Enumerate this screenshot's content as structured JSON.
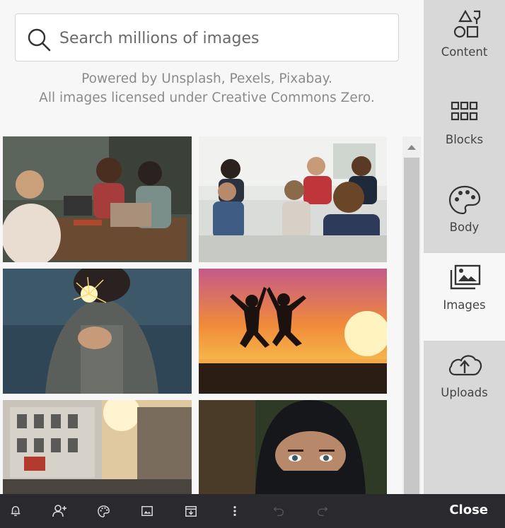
{
  "search": {
    "placeholder": "Search millions of images",
    "icon": "search-icon"
  },
  "credits": {
    "line1": "Powered by Unsplash, Pexels, Pixabay.",
    "line2": "All images licensed under Creative Commons Zero."
  },
  "images": [
    {
      "subject": "friends-at-laptop-table"
    },
    {
      "subject": "office-team-meeting"
    },
    {
      "subject": "woman-holding-sparkler"
    },
    {
      "subject": "people-jumping-at-sunset"
    },
    {
      "subject": "city-street-buildings"
    },
    {
      "subject": "woman-in-niqab"
    }
  ],
  "tabs": [
    {
      "label": "Content",
      "icon": "shapes-icon",
      "active": false
    },
    {
      "label": "Blocks",
      "icon": "grid-icon",
      "active": false
    },
    {
      "label": "Body",
      "icon": "palette-icon",
      "active": false
    },
    {
      "label": "Images",
      "icon": "images-icon",
      "active": true
    },
    {
      "label": "Uploads",
      "icon": "cloud-upload-icon",
      "active": false
    }
  ],
  "toolbar": {
    "icons": [
      "bell-icon",
      "add-user-icon",
      "palette-icon",
      "image-icon",
      "download-icon",
      "more-vertical-icon",
      "undo-icon",
      "redo-icon"
    ],
    "close_label": "Close"
  },
  "colors": {
    "panel_bg": "#f7f7f7",
    "tabbar_bg": "#d8d8d8",
    "toolbar_bg": "#2a2a2e"
  }
}
